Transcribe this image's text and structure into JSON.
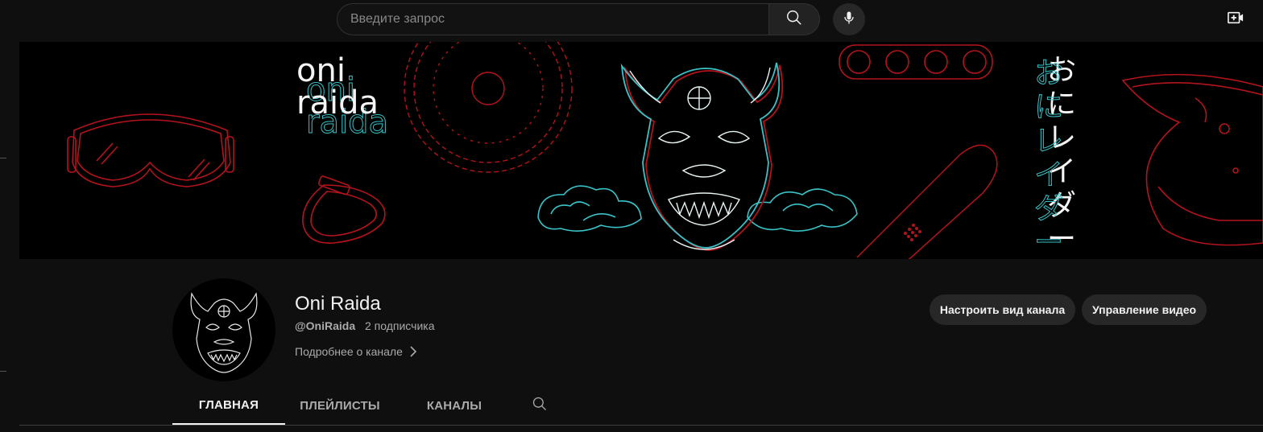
{
  "topbar": {
    "search_placeholder": "Введите запрос",
    "icons": {
      "search": "search-icon",
      "mic": "microphone-icon",
      "create": "video-create-icon"
    }
  },
  "banner": {
    "logo_line1": "oni",
    "logo_line2": "raida",
    "japanese_chars": [
      "お",
      "に",
      "レ",
      "イ",
      "ダ",
      "ー"
    ],
    "colors": {
      "red": "#b3141c",
      "teal": "#39c3c8",
      "white": "#f4f4f4",
      "background": "#000000"
    }
  },
  "channel": {
    "name": "Oni Raida",
    "handle": "@OniRaida",
    "subscribers": "2 подписчика",
    "about_label": "Подробнее о канале",
    "buttons": {
      "customize": "Настроить вид канала",
      "manage": "Управление видео"
    }
  },
  "tabs": [
    {
      "label": "ГЛАВНАЯ",
      "active": true
    },
    {
      "label": "ПЛЕЙЛИСТЫ",
      "active": false
    },
    {
      "label": "КАНАЛЫ",
      "active": false
    }
  ],
  "theme": {
    "background": "#0f0f0f",
    "button_bg": "#272727",
    "text_primary": "#f1f1f1",
    "text_secondary": "#aaaaaa"
  }
}
